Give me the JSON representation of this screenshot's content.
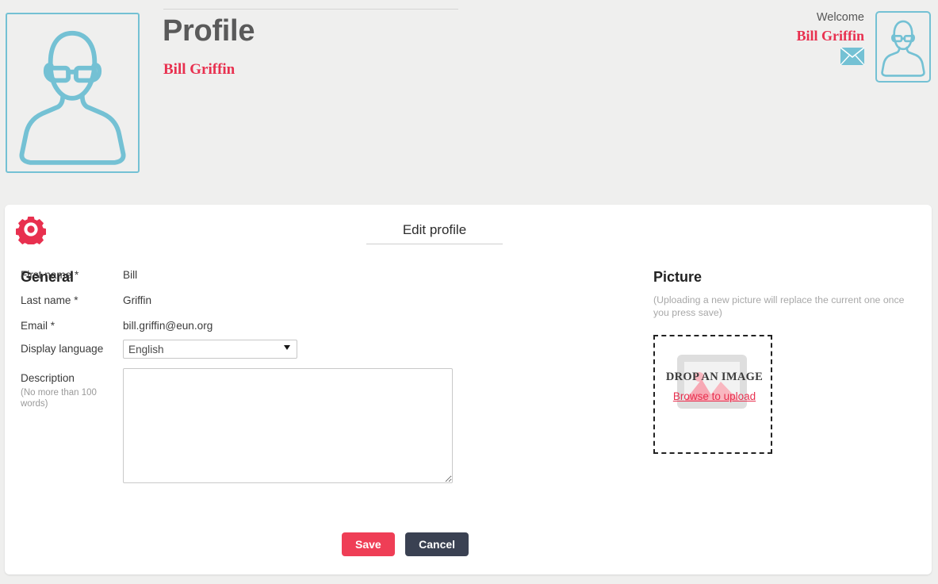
{
  "colors": {
    "page_bg": "#efefee",
    "accent_red": "#e8304f",
    "teal": "#74c1d4",
    "save_red": "#ef3e56",
    "cancel_dark": "#3a4152",
    "card_bg": "#ffffff"
  },
  "header": {
    "title": "Profile",
    "subname": "Bill Griffin",
    "avatar_icon": "user-avatar-glasses-icon"
  },
  "topbar": {
    "welcome_label": "Welcome",
    "user_name": "Bill Griffin",
    "mail_icon": "envelope-icon",
    "avatar_icon": "user-avatar-glasses-icon"
  },
  "card": {
    "gear_icon": "gear-icon",
    "tab_label": "Edit profile"
  },
  "general": {
    "heading": "General",
    "fields": [
      {
        "label": "First name *",
        "value": "Bill"
      },
      {
        "label": "Last name *",
        "value": "Griffin"
      },
      {
        "label": "Email *",
        "value": "bill.griffin@eun.org"
      }
    ],
    "language": {
      "label": "Display language",
      "selected": "English",
      "options": [
        "English"
      ]
    },
    "description": {
      "label": "Description",
      "hint": "(No more than 100 words)",
      "value": "",
      "placeholder": ""
    }
  },
  "actions": {
    "save_label": "Save",
    "cancel_label": "Cancel"
  },
  "picture": {
    "heading": "Picture",
    "note": "(Uploading a new picture will replace the current one once you press save)",
    "dropzone_text": "DROP AN IMAGE",
    "browse_link": "Browse to upload",
    "placeholder_icon": "image-placeholder-icon"
  }
}
